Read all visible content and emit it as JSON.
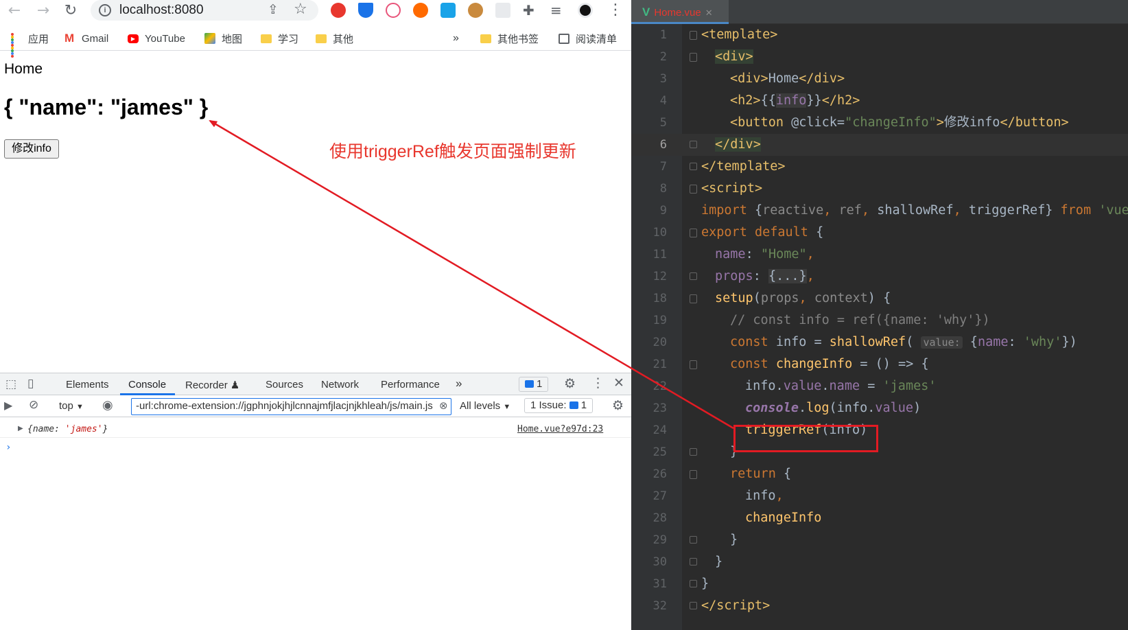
{
  "browser": {
    "url": "localhost:8080",
    "bookmarks": {
      "apps": "应用",
      "gmail": "Gmail",
      "youtube": "YouTube",
      "maps": "地图",
      "study": "学习",
      "other": "其他",
      "more": "»",
      "other_bookmarks": "其他书签",
      "reading_list": "阅读清单"
    },
    "page": {
      "home_text": "Home",
      "h2_text": "{ \"name\": \"james\" }",
      "button_label": "修改info"
    }
  },
  "annotation": "使用triggerRef触发页面强制更新",
  "devtools": {
    "tabs": [
      "Elements",
      "Console",
      "Recorder ♟",
      "Sources",
      "Network",
      "Performance"
    ],
    "more_tabs": "»",
    "message_badge": "1",
    "context": "top",
    "filter_value": "-url:chrome-extension://jgphnjokjhjlcnnajmfjlacjnjkhleah/js/main.js",
    "levels": "All levels",
    "issues": "1 Issue:",
    "issues_count": "1",
    "log_obj_prefix": "{name: ",
    "log_obj_value": "'james'",
    "log_obj_suffix": "}",
    "log_source": "Home.vue?e97d:23",
    "prompt": "›"
  },
  "editor": {
    "tab_label": "Home.vue",
    "line_numbers": [
      "1",
      "2",
      "3",
      "4",
      "5",
      "6",
      "7",
      "8",
      "9",
      "10",
      "11",
      "12",
      "18",
      "19",
      "20",
      "21",
      "22",
      "23",
      "24",
      "25",
      "26",
      "27",
      "28",
      "29",
      "30",
      "31",
      "32"
    ],
    "current_line": "6"
  },
  "colors": {
    "annotation": "#e8372e",
    "highlight_box": "#e21b23",
    "editor_bg": "#2b2b2b",
    "link_blue": "#1a73e8"
  }
}
